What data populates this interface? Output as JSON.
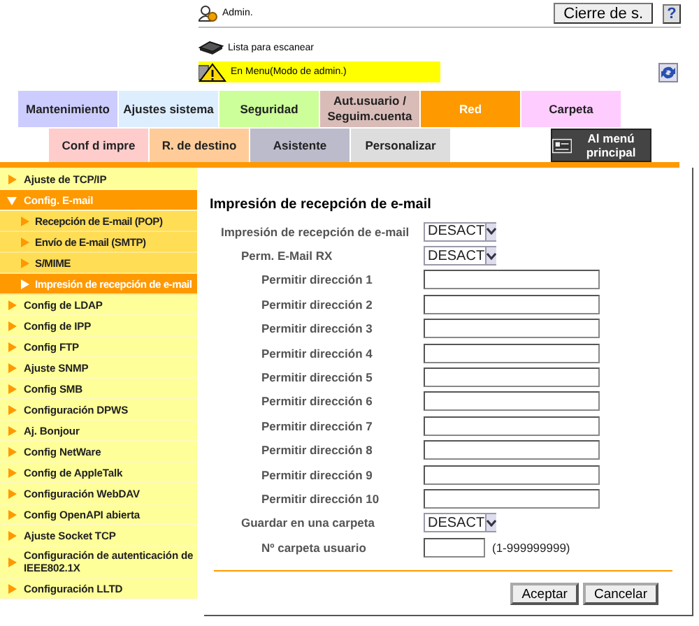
{
  "header": {
    "user": "Admin.",
    "logout_button": "Cierre de s.",
    "help_button": "?",
    "status": "Lista para escanear",
    "alert": "En Menu(Modo de admin.)"
  },
  "tabs": {
    "row_1": [
      {
        "label": "Mantenimiento",
        "color": "#ccccff",
        "selected": false
      },
      {
        "label": "Ajustes sistema",
        "color": "#ddeeff",
        "selected": false
      },
      {
        "label": "Seguridad",
        "color": "#ccff99",
        "selected": false
      },
      {
        "label": "Aut.usuario / Seguim.cuenta",
        "color": "#d9bcb8",
        "selected": false
      },
      {
        "label": "Red",
        "color": "#ff9900",
        "selected": true
      },
      {
        "label": "Carpeta",
        "color": "#ffccff",
        "selected": false
      }
    ],
    "row_2": [
      {
        "label": "Conf d impre",
        "color": "#ffcccc",
        "selected": false
      },
      {
        "label": "R. de destino",
        "color": "#ffcc99",
        "selected": false
      },
      {
        "label": "Asistente",
        "color": "#bbbbcc",
        "selected": false
      },
      {
        "label": "Personalizar",
        "color": "#dddddd",
        "selected": false
      }
    ]
  },
  "main_menu_button": "Al menú principal",
  "sidebar": {
    "items": [
      {
        "label": "Ajuste de TCP/IP",
        "selected": false,
        "expanded": false
      },
      {
        "label": "Config. E-mail",
        "selected": false,
        "expanded": true,
        "children": [
          {
            "label": "Recepción de E-mail (POP)",
            "selected": false
          },
          {
            "label": "Envío de E-mail (SMTP)",
            "selected": false
          },
          {
            "label": "S/MIME",
            "selected": false
          },
          {
            "label": "Impresión de recepción de e-mail",
            "selected": true
          }
        ]
      },
      {
        "label": "Config de LDAP",
        "selected": false,
        "expanded": false
      },
      {
        "label": "Config de IPP",
        "selected": false,
        "expanded": false
      },
      {
        "label": "Config FTP",
        "selected": false,
        "expanded": false
      },
      {
        "label": "Ajuste SNMP",
        "selected": false,
        "expanded": false
      },
      {
        "label": "Config SMB",
        "selected": false,
        "expanded": false
      },
      {
        "label": "Configuración DPWS",
        "selected": false,
        "expanded": false
      },
      {
        "label": "Aj. Bonjour",
        "selected": false,
        "expanded": false
      },
      {
        "label": "Config NetWare",
        "selected": false,
        "expanded": false
      },
      {
        "label": "Config de AppleTalk",
        "selected": false,
        "expanded": false
      },
      {
        "label": "Configuración WebDAV",
        "selected": false,
        "expanded": false
      },
      {
        "label": "Config OpenAPI abierta",
        "selected": false,
        "expanded": false
      },
      {
        "label": "Ajuste Socket TCP",
        "selected": false,
        "expanded": false
      },
      {
        "label": "Configuración de autenticación de IEEE802.1X",
        "selected": false,
        "expanded": false
      },
      {
        "label": "Configuración LLTD",
        "selected": false,
        "expanded": false
      }
    ]
  },
  "form": {
    "title": "Impresión de recepción de e-mail",
    "fields": [
      {
        "kind": "select",
        "label": "Impresión de recepción de e-mail",
        "value": "DESACT",
        "children": [
          {
            "kind": "select",
            "label": "Perm. E-Mail RX",
            "value": "DESACT",
            "children": [
              {
                "kind": "text",
                "label": "Permitir dirección 1"
              },
              {
                "kind": "text",
                "label": "Permitir dirección 2"
              },
              {
                "kind": "text",
                "label": "Permitir dirección 3"
              },
              {
                "kind": "text",
                "label": "Permitir dirección 4"
              },
              {
                "kind": "text",
                "label": "Permitir dirección 5"
              },
              {
                "kind": "text",
                "label": "Permitir dirección 6"
              },
              {
                "kind": "text",
                "label": "Permitir dirección 7"
              },
              {
                "kind": "text",
                "label": "Permitir dirección 8"
              },
              {
                "kind": "text",
                "label": "Permitir dirección 9"
              },
              {
                "kind": "text",
                "label": "Permitir dirección 10"
              }
            ]
          },
          {
            "kind": "select",
            "label": "Guardar en una carpeta",
            "value": "DESACT",
            "children": [
              {
                "kind": "number",
                "label": "Nº carpeta usuario",
                "range": "(1-999999999)"
              }
            ]
          }
        ]
      }
    ],
    "buttons": [
      "Aceptar",
      "Cancelar"
    ]
  }
}
